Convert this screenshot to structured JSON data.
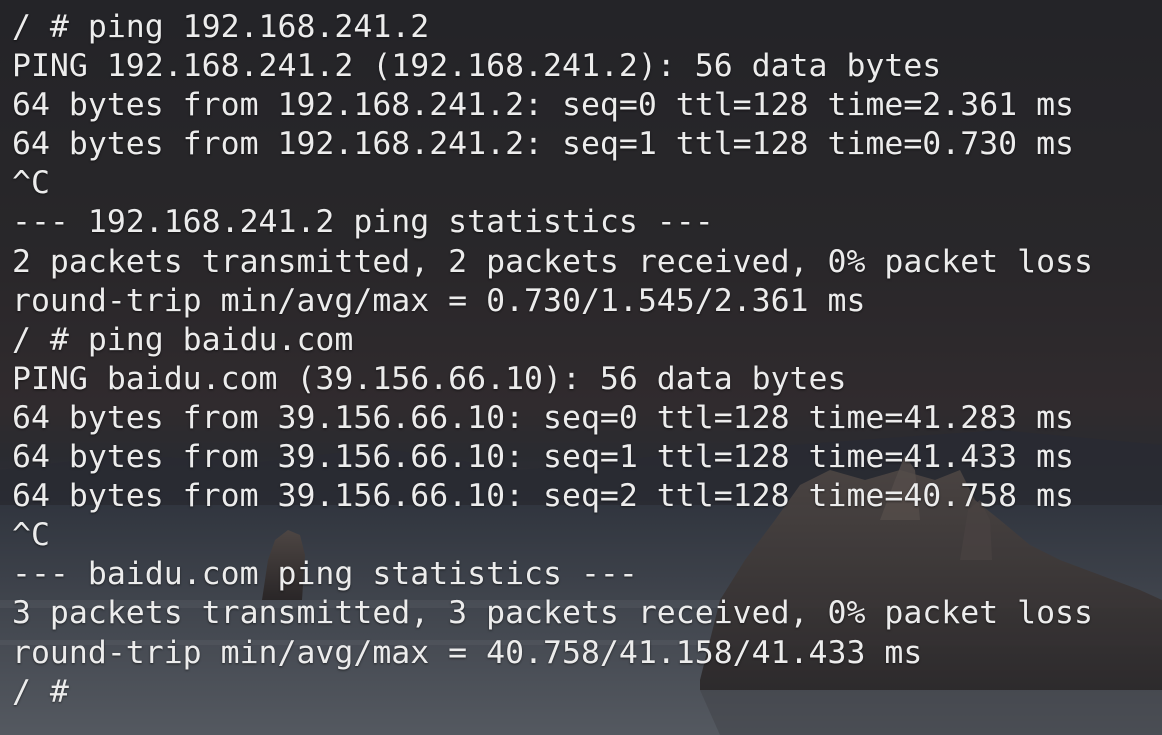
{
  "terminal": {
    "lines": [
      "/ # ping 192.168.241.2",
      "PING 192.168.241.2 (192.168.241.2): 56 data bytes",
      "64 bytes from 192.168.241.2: seq=0 ttl=128 time=2.361 ms",
      "64 bytes from 192.168.241.2: seq=1 ttl=128 time=0.730 ms",
      "^C",
      "--- 192.168.241.2 ping statistics ---",
      "2 packets transmitted, 2 packets received, 0% packet loss",
      "round-trip min/avg/max = 0.730/1.545/2.361 ms",
      "/ # ping baidu.com",
      "PING baidu.com (39.156.66.10): 56 data bytes",
      "64 bytes from 39.156.66.10: seq=0 ttl=128 time=41.283 ms",
      "64 bytes from 39.156.66.10: seq=1 ttl=128 time=41.433 ms",
      "64 bytes from 39.156.66.10: seq=2 ttl=128 time=40.758 ms",
      "^C",
      "--- baidu.com ping statistics ---",
      "3 packets transmitted, 3 packets received, 0% packet loss",
      "round-trip min/avg/max = 40.758/41.158/41.433 ms",
      "/ #"
    ]
  },
  "colors": {
    "text": "#ececec",
    "sky_top": "#2f2f33",
    "water": "#8a95a2"
  }
}
